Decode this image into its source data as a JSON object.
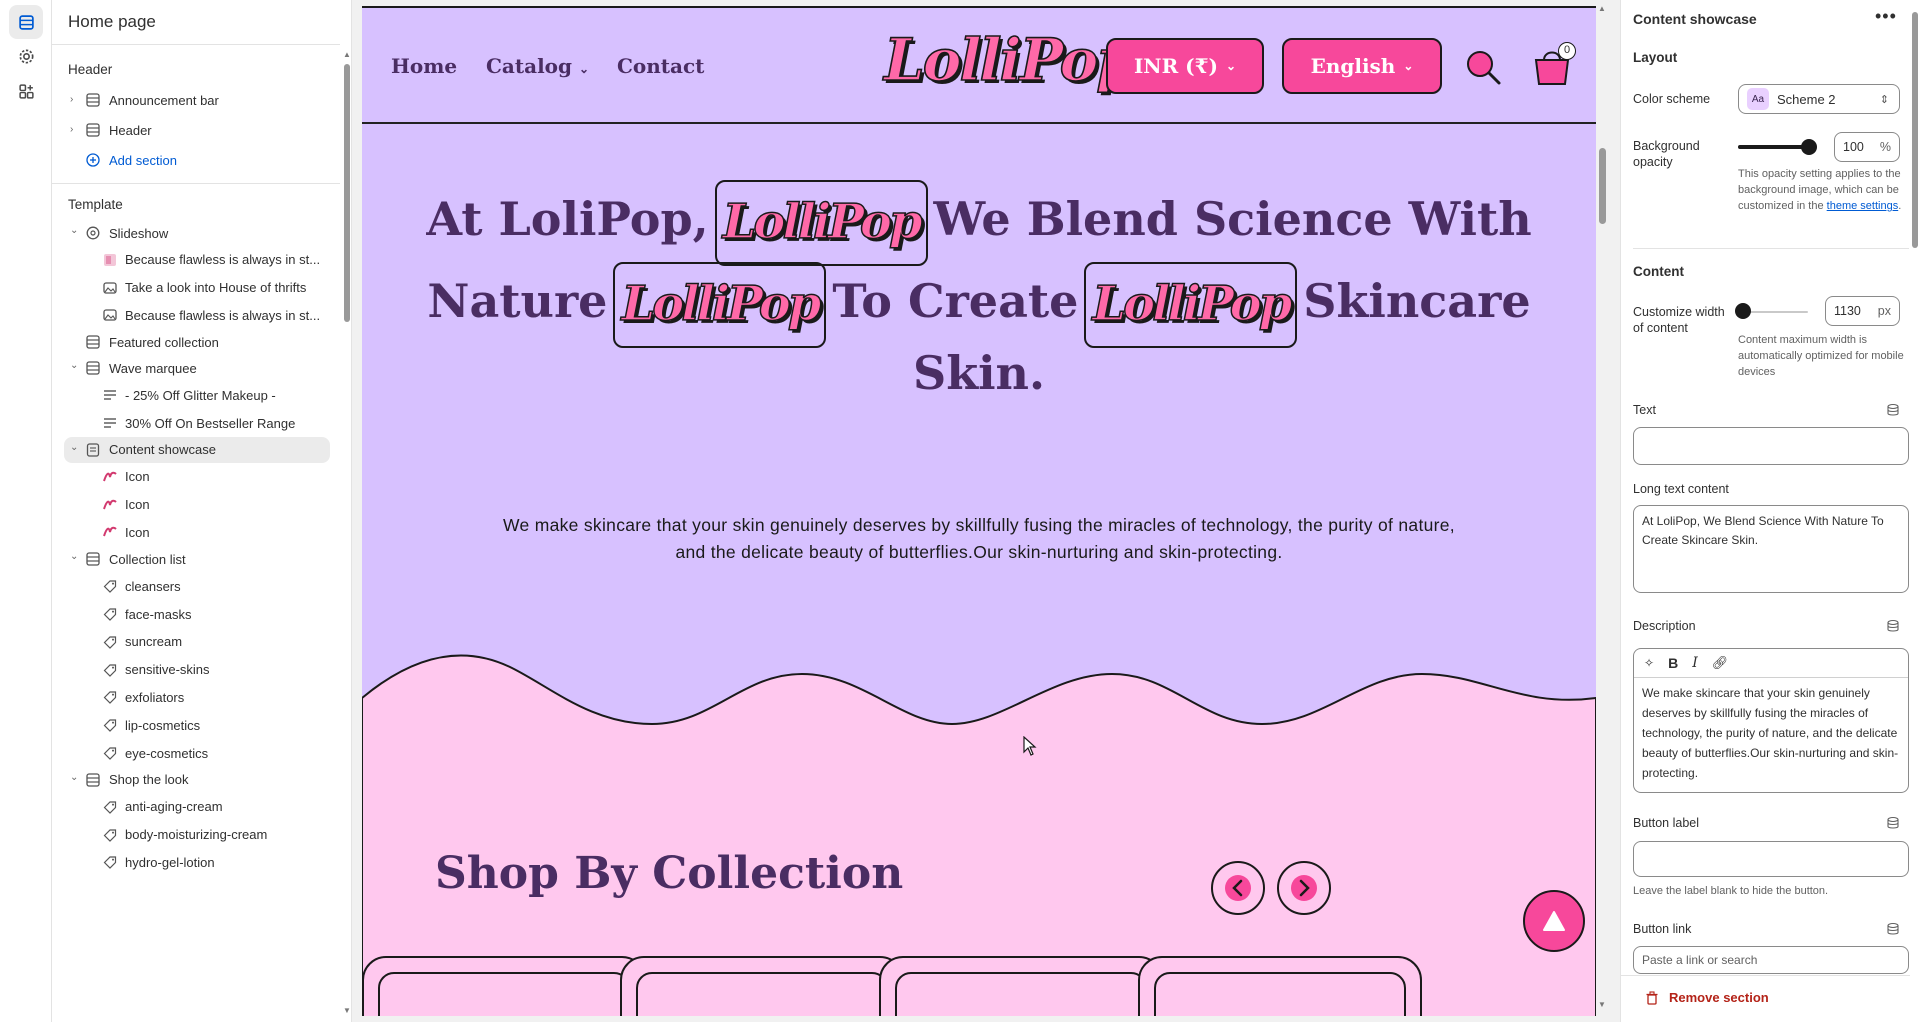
{
  "sidebar": {
    "title": "Home page",
    "header_group": "Header",
    "header_items": [
      "Announcement bar",
      "Header"
    ],
    "add_section": "Add section",
    "template_group": "Template",
    "template": [
      {
        "label": "Slideshow",
        "level": 1,
        "chev": "v"
      },
      {
        "label": "Because flawless is always in st...",
        "level": 2
      },
      {
        "label": "Take a look into House of thrifts",
        "level": 2
      },
      {
        "label": "Because flawless is always in st...",
        "level": 2
      },
      {
        "label": "Featured collection",
        "level": 1
      },
      {
        "label": "Wave marquee",
        "level": 1,
        "chev": "v"
      },
      {
        "label": "- 25% Off Glitter Makeup -",
        "level": 2
      },
      {
        "label": "30% Off On Bestseller Range",
        "level": 2
      },
      {
        "label": "Content showcase",
        "level": 1,
        "chev": "v"
      },
      {
        "label": "Icon",
        "level": 2
      },
      {
        "label": "Icon",
        "level": 2
      },
      {
        "label": "Icon",
        "level": 2
      },
      {
        "label": "Collection list",
        "level": 1,
        "chev": "v"
      },
      {
        "label": "cleansers",
        "level": 2
      },
      {
        "label": "face-masks",
        "level": 2
      },
      {
        "label": "suncream",
        "level": 2
      },
      {
        "label": "sensitive-skins",
        "level": 2
      },
      {
        "label": "exfoliators",
        "level": 2
      },
      {
        "label": "lip-cosmetics",
        "level": 2
      },
      {
        "label": "eye-cosmetics",
        "level": 2
      },
      {
        "label": "Shop the look",
        "level": 1,
        "chev": "v"
      },
      {
        "label": "anti-aging-cream",
        "level": 2
      },
      {
        "label": "body-moisturizing-cream",
        "level": 2
      },
      {
        "label": "hydro-gel-lotion",
        "level": 2
      }
    ]
  },
  "preview": {
    "nav": {
      "home": "Home",
      "catalog": "Catalog",
      "contact": "Contact",
      "currency": "INR (₹)",
      "language": "English",
      "cart_count": "0"
    },
    "logo_text": "LolliPop",
    "hero": {
      "line1_a": "At LoliPop,",
      "line1_b": "We Blend Science With",
      "line2_a": "Nature",
      "line2_b": "To Create",
      "line2_c": "Skincare",
      "line3": "Skin.",
      "description": "We make skincare that your skin genuinely deserves by skillfully fusing the miracles of technology, the purity of nature, and the delicate beauty of butterflies.Our skin-nurturing and skin-protecting."
    },
    "shop_title": "Shop By Collection",
    "colors": {
      "lavender": "#d7c1ff",
      "pink": "#ffc8ee",
      "accent": "#f7489b",
      "heading": "#4a2d63"
    }
  },
  "panel": {
    "title": "Content showcase",
    "layout_heading": "Layout",
    "color_scheme_label": "Color scheme",
    "color_scheme_value": "Scheme 2",
    "aa": "Aa",
    "bg_opacity_label": "Background opacity",
    "bg_opacity_value": "100",
    "bg_opacity_level": 1.0,
    "percent": "%",
    "opacity_help": "This opacity setting applies to the background image, which can be customized in the",
    "theme_settings": "theme settings",
    "content_heading": "Content",
    "width_label": "Customize width of content",
    "width_value": "1130",
    "width_level": 0.05,
    "px": "px",
    "width_help": "Content maximum width is automatically optimized for mobile devices",
    "text_label": "Text",
    "text_value": "",
    "long_text_label": "Long text content",
    "long_text_value": "At LoliPop, We Blend Science With Nature To Create Skincare Skin.",
    "description_label": "Description",
    "description_value": "We make skincare that your skin genuinely deserves by skillfully fusing the miracles of technology, the purity of nature, and the delicate beauty of butterflies.Our skin-nurturing and skin-protecting.",
    "button_label_label": "Button label",
    "button_label_help": "Leave the label blank to hide the button.",
    "button_link_label": "Button link",
    "button_link_placeholder": "Paste a link or search",
    "remove_section": "Remove section"
  }
}
